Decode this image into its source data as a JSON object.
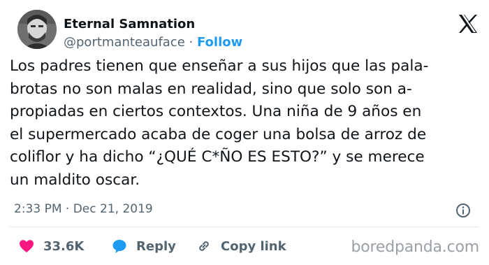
{
  "author": {
    "name": "Eternal Samnation",
    "handle": "@portmanteauface",
    "separator": "·",
    "follow_label": "Follow"
  },
  "tweet_lines": [
    "Los padres tienen que enseñar a sus hijos que las pala-",
    "brotas no son malas en realidad, sino que solo son a-",
    "propiadas en ciertos contextos. Una niña de 9 años en",
    "el supermercado acaba de coger una bolsa de arroz de",
    "coliflor y ha dicho “¿QUÉ C*ÑO ES ESTO?” y se merece",
    "un maldito oscar."
  ],
  "meta": {
    "time": "2:33 PM",
    "separator": "·",
    "date": "Dec 21, 2019"
  },
  "actions": {
    "like_count": "33.6K",
    "reply_label": "Reply",
    "copy_link_label": "Copy link"
  },
  "watermark": "boredpanda.com",
  "colors": {
    "like": "#f91880",
    "reply": "#1d9bf0",
    "follow": "#1d9bf0",
    "muted": "#536471"
  },
  "icons": [
    "x-logo-icon",
    "info-icon",
    "heart-icon",
    "reply-bubble-icon",
    "link-icon"
  ]
}
